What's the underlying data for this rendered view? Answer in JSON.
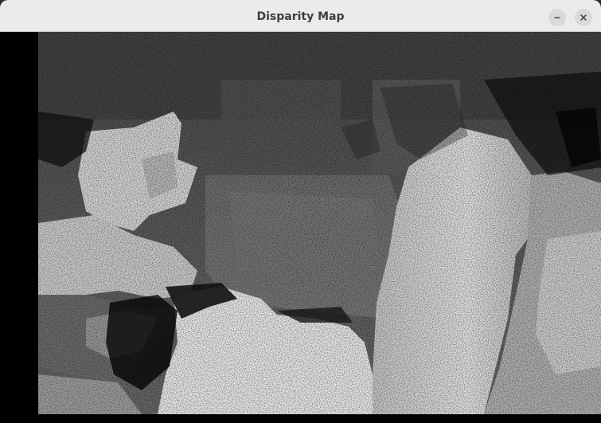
{
  "window": {
    "title": "Disparity Map",
    "controls": [
      {
        "name": "minimize",
        "icon": "minimize-icon"
      },
      {
        "name": "close",
        "icon": "close-icon"
      }
    ]
  },
  "image": {
    "kind": "grayscale disparity map"
  },
  "colors": {
    "titlebar": "#ebebeb",
    "title_text": "#3d3d3d",
    "button_bg": "#d9d9d9",
    "background": "#000000"
  }
}
